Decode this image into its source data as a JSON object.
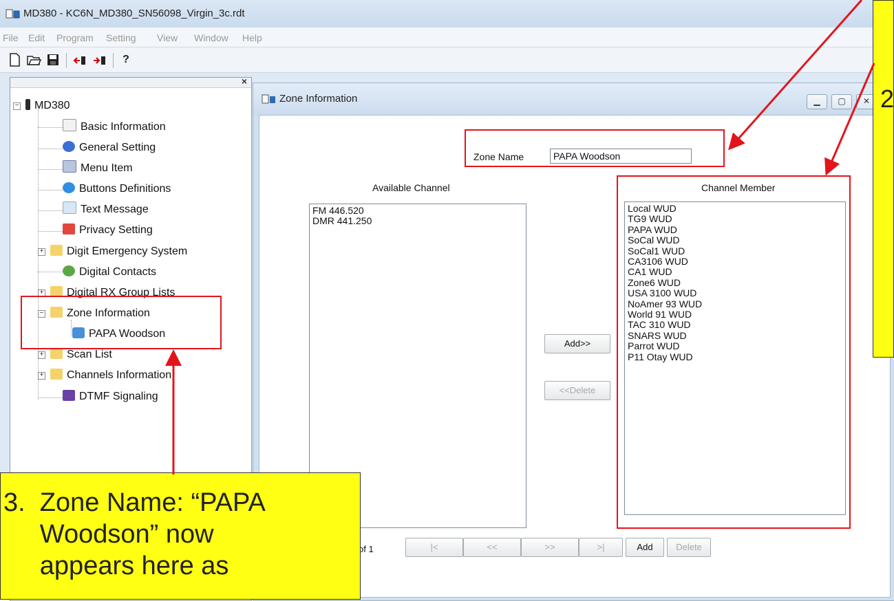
{
  "window": {
    "title": "MD380 - KC6N_MD380_SN56098_Virgin_3c.rdt"
  },
  "menu": [
    "File",
    "Edit",
    "Program",
    "Setting",
    "View",
    "Window",
    "Help"
  ],
  "toolbar": {
    "icons": [
      "new-icon",
      "open-icon",
      "save-icon",
      "read-from-radio-icon",
      "write-to-radio-icon",
      "help-icon"
    ],
    "help_glyph": "?"
  },
  "tree": {
    "close_glyph": "×",
    "root": "MD380",
    "items": [
      {
        "label": "Basic Information"
      },
      {
        "label": "General Setting"
      },
      {
        "label": "Menu Item"
      },
      {
        "label": "Buttons Definitions"
      },
      {
        "label": "Text Message"
      },
      {
        "label": "Privacy Setting"
      },
      {
        "label": "Digit Emergency System"
      },
      {
        "label": "Digital Contacts"
      },
      {
        "label": "Digital RX Group Lists"
      },
      {
        "label": "Zone Information"
      },
      {
        "label": "PAPA Woodson"
      },
      {
        "label": "Scan List"
      },
      {
        "label": "Channels Information"
      },
      {
        "label": "DTMF Signaling"
      }
    ]
  },
  "zone_window": {
    "title": "Zone Information",
    "zone_name_label": "Zone Name",
    "zone_name_value": "PAPA Woodson",
    "available_header": "Available Channel",
    "member_header": "Channel Member",
    "available_channels": [
      "FM 446.520",
      "DMR 441.250"
    ],
    "channel_members": [
      "Local WUD",
      "TG9 WUD",
      "PAPA WUD",
      "SoCal WUD",
      "SoCal1 WUD",
      "CA3106 WUD",
      "CA1 WUD",
      "Zone6 WUD",
      "USA 3100 WUD",
      "NoAmer 93 WUD",
      "World 91 WUD",
      "TAC 310 WUD",
      "SNARS WUD",
      "Parrot WUD",
      "P11 Otay WUD"
    ],
    "add_button": "Add>>",
    "delete_button": "<<Delete",
    "page_of": "of 1",
    "nav_first": "|<",
    "nav_prev": "<<",
    "nav_next": ">>",
    "nav_last": ">|",
    "nav_add": "Add",
    "nav_delete": "Delete"
  },
  "annotations": {
    "callout_text": "3.  Zone Name: “PAPA\n     Woodson” now\n     appears here as",
    "right_fragment": "2",
    "colors": {
      "arrow": "#e3151c",
      "callout": "#ffff14"
    }
  }
}
